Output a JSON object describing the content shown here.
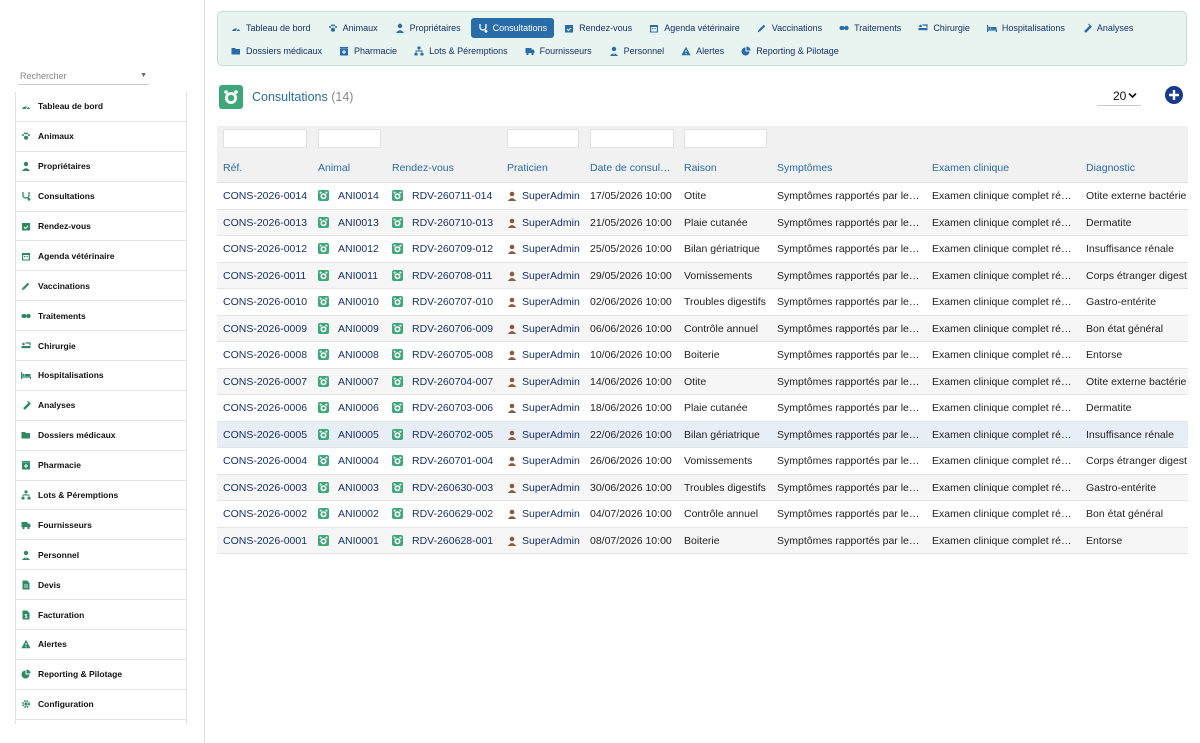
{
  "sidebar": {
    "search_placeholder": "Rechercher",
    "items": [
      {
        "label": "Tableau de bord",
        "icon": "dashboard-icon"
      },
      {
        "label": "Animaux",
        "icon": "paw-icon"
      },
      {
        "label": "Propriétaires",
        "icon": "user-icon"
      },
      {
        "label": "Consultations",
        "icon": "stethoscope-icon"
      },
      {
        "label": "Rendez-vous",
        "icon": "calendar-check-icon"
      },
      {
        "label": "Agenda vétérinaire",
        "icon": "calendar-icon"
      },
      {
        "label": "Vaccinations",
        "icon": "syringe-icon"
      },
      {
        "label": "Traitements",
        "icon": "pills-icon"
      },
      {
        "label": "Chirurgie",
        "icon": "procedures-icon"
      },
      {
        "label": "Hospitalisations",
        "icon": "bed-icon"
      },
      {
        "label": "Analyses",
        "icon": "vial-icon"
      },
      {
        "label": "Dossiers médicaux",
        "icon": "folder-open-icon"
      },
      {
        "label": "Pharmacie",
        "icon": "clinic-icon"
      },
      {
        "label": "Lots & Péremptions",
        "icon": "sitemap-icon"
      },
      {
        "label": "Fournisseurs",
        "icon": "truck-icon"
      },
      {
        "label": "Personnel",
        "icon": "user-tie-icon"
      },
      {
        "label": "Devis",
        "icon": "file-quote-icon"
      },
      {
        "label": "Facturation",
        "icon": "invoice-icon"
      },
      {
        "label": "Alertes",
        "icon": "warning-icon"
      },
      {
        "label": "Reporting & Pilotage",
        "icon": "chart-pie-icon"
      },
      {
        "label": "Configuration",
        "icon": "gear-icon"
      }
    ]
  },
  "topnav": {
    "row1": [
      {
        "label": "Tableau de bord",
        "icon": "dashboard-icon"
      },
      {
        "label": "Animaux",
        "icon": "paw-icon"
      },
      {
        "label": "Propriétaires",
        "icon": "user-icon"
      },
      {
        "label": "Consultations",
        "icon": "stethoscope-icon",
        "active": true
      },
      {
        "label": "Rendez-vous",
        "icon": "calendar-check-icon"
      },
      {
        "label": "Agenda vétérinaire",
        "icon": "calendar-icon"
      },
      {
        "label": "Vaccinations",
        "icon": "syringe-icon"
      },
      {
        "label": "Traitements",
        "icon": "pills-icon"
      },
      {
        "label": "Chirurgie",
        "icon": "procedures-icon"
      },
      {
        "label": "Hospitalisations",
        "icon": "bed-icon"
      },
      {
        "label": "Analyses",
        "icon": "vial-icon"
      }
    ],
    "row2": [
      {
        "label": "Dossiers médicaux",
        "icon": "folder-open-icon"
      },
      {
        "label": "Pharmacie",
        "icon": "clinic-icon"
      },
      {
        "label": "Lots & Péremptions",
        "icon": "sitemap-icon"
      },
      {
        "label": "Fournisseurs",
        "icon": "truck-icon"
      },
      {
        "label": "Personnel",
        "icon": "user-tie-icon"
      },
      {
        "label": "Alertes",
        "icon": "warning-icon"
      },
      {
        "label": "Reporting & Pilotage",
        "icon": "chart-pie-icon"
      }
    ]
  },
  "header": {
    "title": "Consultations",
    "count": "(14)",
    "page_size": "20",
    "accent": "#2a6ca8",
    "logo_color": "#3fa87b"
  },
  "table": {
    "columns": [
      "Réf.",
      "Animal",
      "Rendez-vous",
      "Praticien",
      "Date de consul…",
      "Raison",
      "Symptômes",
      "Examen clinique",
      "Diagnostic"
    ],
    "rows": [
      {
        "ref": "CONS-2026-0014",
        "animal": "ANI0014",
        "rdv": "RDV-260711-014",
        "praticien": "SuperAdmin",
        "date": "17/05/2026 10:00",
        "raison": "Otite",
        "symptomes": "Symptômes rapportés par le…",
        "examen": "Examen clinique complet ré…",
        "diagnostic": "Otite externe bactérie"
      },
      {
        "ref": "CONS-2026-0013",
        "animal": "ANI0013",
        "rdv": "RDV-260710-013",
        "praticien": "SuperAdmin",
        "date": "21/05/2026 10:00",
        "raison": "Plaie cutanée",
        "symptomes": "Symptômes rapportés par le…",
        "examen": "Examen clinique complet ré…",
        "diagnostic": "Dermatite"
      },
      {
        "ref": "CONS-2026-0012",
        "animal": "ANI0012",
        "rdv": "RDV-260709-012",
        "praticien": "SuperAdmin",
        "date": "25/05/2026 10:00",
        "raison": "Bilan gériatrique",
        "symptomes": "Symptômes rapportés par le…",
        "examen": "Examen clinique complet ré…",
        "diagnostic": "Insuffisance rénale"
      },
      {
        "ref": "CONS-2026-0011",
        "animal": "ANI0011",
        "rdv": "RDV-260708-011",
        "praticien": "SuperAdmin",
        "date": "29/05/2026 10:00",
        "raison": "Vomissements",
        "symptomes": "Symptômes rapportés par le…",
        "examen": "Examen clinique complet ré…",
        "diagnostic": "Corps étranger digest"
      },
      {
        "ref": "CONS-2026-0010",
        "animal": "ANI0010",
        "rdv": "RDV-260707-010",
        "praticien": "SuperAdmin",
        "date": "02/06/2026 10:00",
        "raison": "Troubles digestifs",
        "symptomes": "Symptômes rapportés par le…",
        "examen": "Examen clinique complet ré…",
        "diagnostic": "Gastro-entérite"
      },
      {
        "ref": "CONS-2026-0009",
        "animal": "ANI0009",
        "rdv": "RDV-260706-009",
        "praticien": "SuperAdmin",
        "date": "06/06/2026 10:00",
        "raison": "Contrôle annuel",
        "symptomes": "Symptômes rapportés par le…",
        "examen": "Examen clinique complet ré…",
        "diagnostic": "Bon état général"
      },
      {
        "ref": "CONS-2026-0008",
        "animal": "ANI0008",
        "rdv": "RDV-260705-008",
        "praticien": "SuperAdmin",
        "date": "10/06/2026 10:00",
        "raison": "Boiterie",
        "symptomes": "Symptômes rapportés par le…",
        "examen": "Examen clinique complet ré…",
        "diagnostic": "Entorse"
      },
      {
        "ref": "CONS-2026-0007",
        "animal": "ANI0007",
        "rdv": "RDV-260704-007",
        "praticien": "SuperAdmin",
        "date": "14/06/2026 10:00",
        "raison": "Otite",
        "symptomes": "Symptômes rapportés par le…",
        "examen": "Examen clinique complet ré…",
        "diagnostic": "Otite externe bactérie"
      },
      {
        "ref": "CONS-2026-0006",
        "animal": "ANI0006",
        "rdv": "RDV-260703-006",
        "praticien": "SuperAdmin",
        "date": "18/06/2026 10:00",
        "raison": "Plaie cutanée",
        "symptomes": "Symptômes rapportés par le…",
        "examen": "Examen clinique complet ré…",
        "diagnostic": "Dermatite"
      },
      {
        "ref": "CONS-2026-0005",
        "animal": "ANI0005",
        "rdv": "RDV-260702-005",
        "praticien": "SuperAdmin",
        "date": "22/06/2026 10:00",
        "raison": "Bilan gériatrique",
        "symptomes": "Symptômes rapportés par le…",
        "examen": "Examen clinique complet ré…",
        "diagnostic": "Insuffisance rénale"
      },
      {
        "ref": "CONS-2026-0004",
        "animal": "ANI0004",
        "rdv": "RDV-260701-004",
        "praticien": "SuperAdmin",
        "date": "26/06/2026 10:00",
        "raison": "Vomissements",
        "symptomes": "Symptômes rapportés par le…",
        "examen": "Examen clinique complet ré…",
        "diagnostic": "Corps étranger digest"
      },
      {
        "ref": "CONS-2026-0003",
        "animal": "ANI0003",
        "rdv": "RDV-260630-003",
        "praticien": "SuperAdmin",
        "date": "30/06/2026 10:00",
        "raison": "Troubles digestifs",
        "symptomes": "Symptômes rapportés par le…",
        "examen": "Examen clinique complet ré…",
        "diagnostic": "Gastro-entérite"
      },
      {
        "ref": "CONS-2026-0002",
        "animal": "ANI0002",
        "rdv": "RDV-260629-002",
        "praticien": "SuperAdmin",
        "date": "04/07/2026 10:00",
        "raison": "Contrôle annuel",
        "symptomes": "Symptômes rapportés par le…",
        "examen": "Examen clinique complet ré…",
        "diagnostic": "Bon état général"
      },
      {
        "ref": "CONS-2026-0001",
        "animal": "ANI0001",
        "rdv": "RDV-260628-001",
        "praticien": "SuperAdmin",
        "date": "08/07/2026 10:00",
        "raison": "Boiterie",
        "symptomes": "Symptômes rapportés par le…",
        "examen": "Examen clinique complet ré…",
        "diagnostic": "Entorse"
      }
    ]
  }
}
